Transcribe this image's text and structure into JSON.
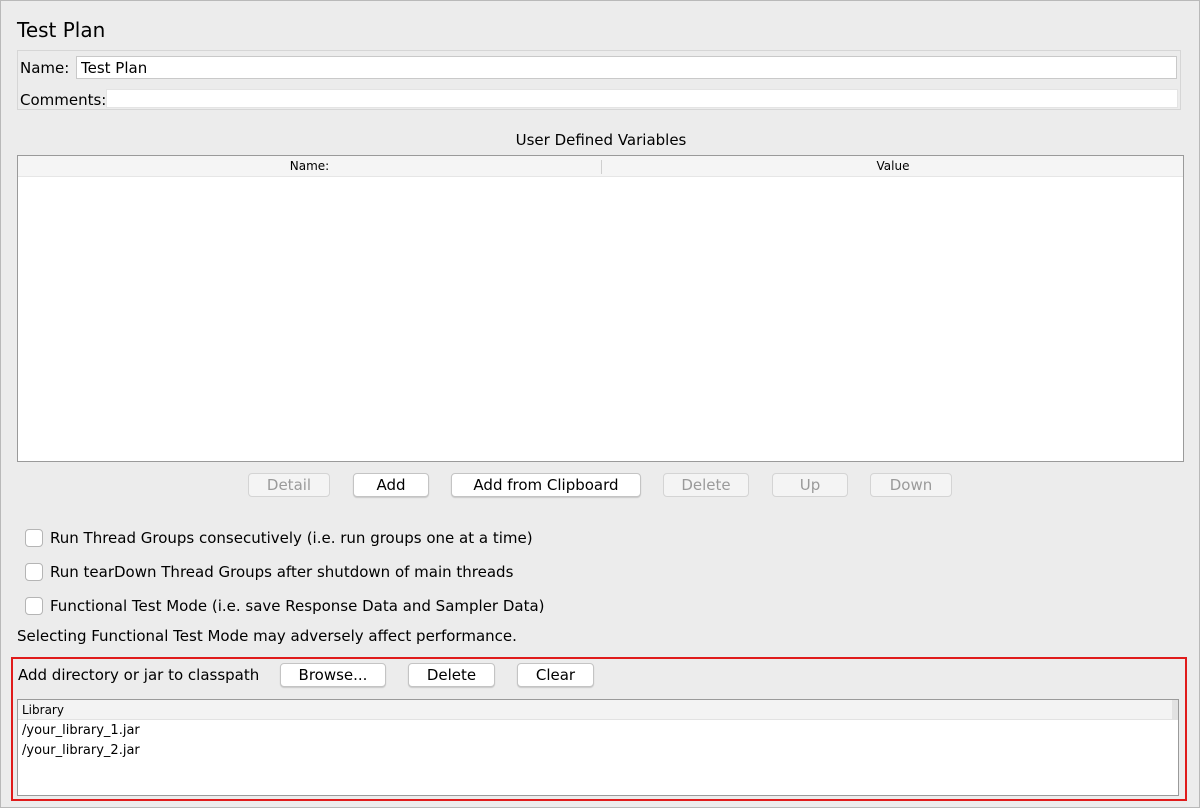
{
  "page": {
    "title": "Test Plan"
  },
  "fields": {
    "name_label": "Name:",
    "name_value": "Test Plan",
    "comments_label": "Comments:",
    "comments_value": ""
  },
  "variables": {
    "title": "User Defined Variables",
    "columns": [
      "Name:",
      "Value"
    ],
    "rows": []
  },
  "variable_buttons": [
    {
      "label": "Detail",
      "enabled": false
    },
    {
      "label": "Add",
      "enabled": true
    },
    {
      "label": "Add from Clipboard",
      "enabled": true
    },
    {
      "label": "Delete",
      "enabled": false
    },
    {
      "label": "Up",
      "enabled": false
    },
    {
      "label": "Down",
      "enabled": false
    }
  ],
  "options": [
    {
      "label": "Run Thread Groups consecutively (i.e. run groups one at a time)",
      "checked": false
    },
    {
      "label": "Run tearDown Thread Groups after shutdown of main threads",
      "checked": false
    },
    {
      "label": "Functional Test Mode (i.e. save Response Data and Sampler Data)",
      "checked": false
    }
  ],
  "warning": "Selecting Functional Test Mode may adversely affect performance.",
  "classpath": {
    "label": "Add directory or jar to classpath",
    "browse_label": "Browse...",
    "delete_label": "Delete",
    "clear_label": "Clear",
    "column": "Library",
    "libraries": [
      "/your_library_1.jar",
      "/your_library_2.jar"
    ]
  },
  "colors": {
    "highlight_border": "#e01b1b",
    "background": "#ececec"
  }
}
